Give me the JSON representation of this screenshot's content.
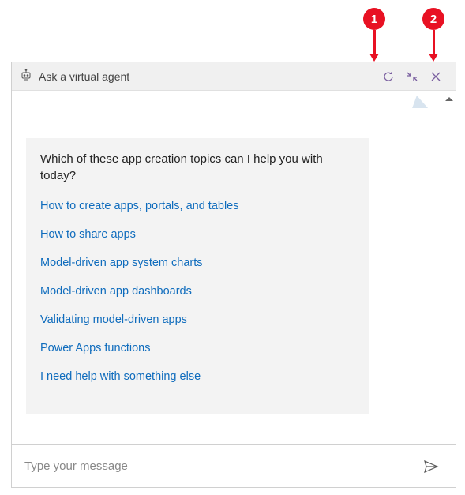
{
  "callouts": {
    "one": "1",
    "two": "2"
  },
  "header": {
    "title": "Ask a virtual agent"
  },
  "message": {
    "question": "Which of these app creation topics can I help you with today?",
    "topics": [
      "How to create apps, portals, and tables",
      "How to share apps",
      "Model-driven app system charts",
      "Model-driven app dashboards",
      "Validating model-driven apps",
      "Power Apps functions",
      "I need help with something else"
    ]
  },
  "input": {
    "placeholder": "Type your message"
  }
}
